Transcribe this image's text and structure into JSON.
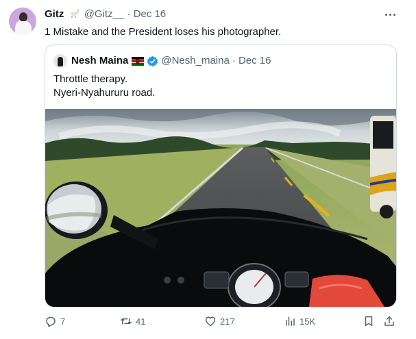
{
  "tweet": {
    "author_name": "Gitz",
    "handle": "@Gitz__",
    "date": "· Dec 16",
    "text": "1 Mistake and the President loses his photographer."
  },
  "quoted_tweet": {
    "author_name": "Nesh Maina",
    "handle": "@Nesh_maina",
    "date": "· Dec 16",
    "text_lines": [
      "Throttle therapy.",
      "Nyeri-Nyahururu road."
    ]
  },
  "actions": {
    "replies": "7",
    "retweets": "41",
    "likes": "217",
    "views": "15K"
  },
  "icons": {
    "more": "more-horizontal-icon",
    "reply": "reply-icon",
    "retweet": "retweet-icon",
    "like": "heart-icon",
    "views": "views-icon",
    "bookmark": "bookmark-icon",
    "share": "share-icon",
    "verified": "verified-badge-icon"
  },
  "colors": {
    "text": "#0f1419",
    "secondary": "#536471",
    "border": "#cfd9de",
    "verified": "#1d9bf0"
  }
}
